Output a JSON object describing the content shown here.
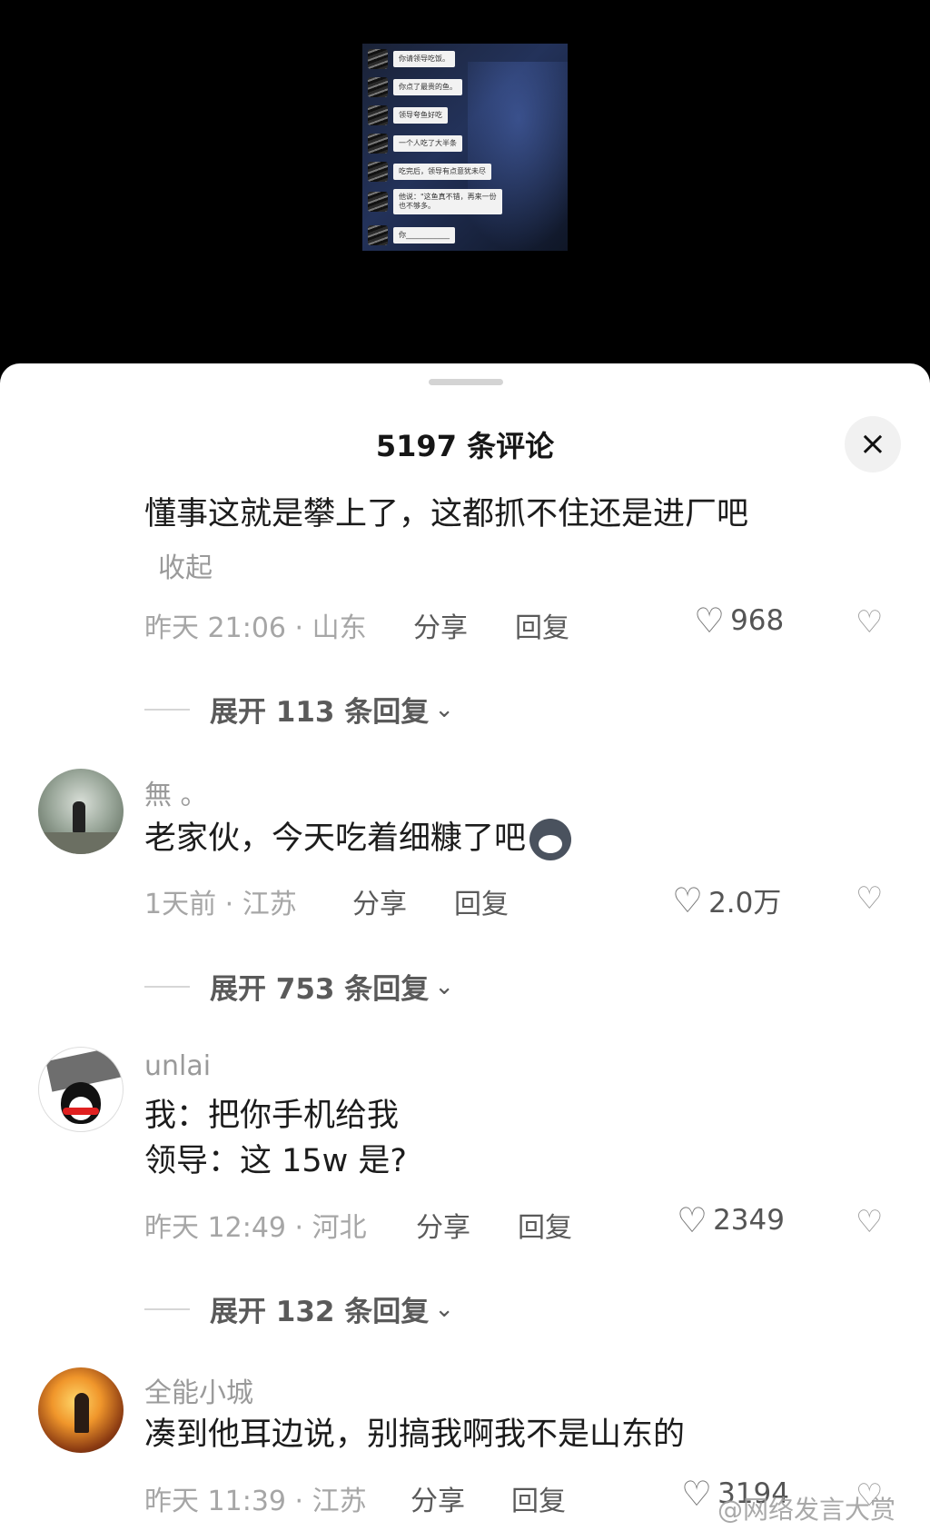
{
  "thumbnail": {
    "messages": [
      "你请领导吃饭。",
      "你点了最贵的鱼。",
      "领导夸鱼好吃",
      "一个人吃了大半条",
      "吃完后，领导有点意犹未尽",
      "他说：\"这鱼真不错，再来一份\n也不够多。",
      "你____________"
    ]
  },
  "sheet": {
    "title": "5197 条评论",
    "close_icon": "×"
  },
  "comments": [
    {
      "text": "懂事这就是攀上了，这都抓不住还是进厂吧",
      "collapse": "收起",
      "meta": "昨天 21:06 · 山东",
      "share": "分享",
      "reply": "回复",
      "likes": "968",
      "expand": "展开 113 条回复"
    },
    {
      "username": "無 。",
      "text": "老家伙，今天吃着细糠了吧",
      "emoji": "dog-emoji",
      "meta": "1天前 · 江苏",
      "share": "分享",
      "reply": "回复",
      "likes": "2.0万",
      "expand": "展开 753 条回复"
    },
    {
      "username": "unlai",
      "text": "我：把你手机给我\n领导：这 15w 是?",
      "meta": "昨天 12:49 · 河北",
      "share": "分享",
      "reply": "回复",
      "likes": "2349",
      "expand": "展开 132 条回复"
    },
    {
      "username": "全能小城",
      "text": "凑到他耳边说，别搞我啊我不是山东的",
      "meta": "昨天 11:39 · 江苏",
      "share": "分享",
      "reply": "回复",
      "likes": "3194"
    }
  ],
  "icons": {
    "heart": "♡",
    "dislike": "♡",
    "chevron": "⌄"
  },
  "watermark": "@网络发言大赏"
}
